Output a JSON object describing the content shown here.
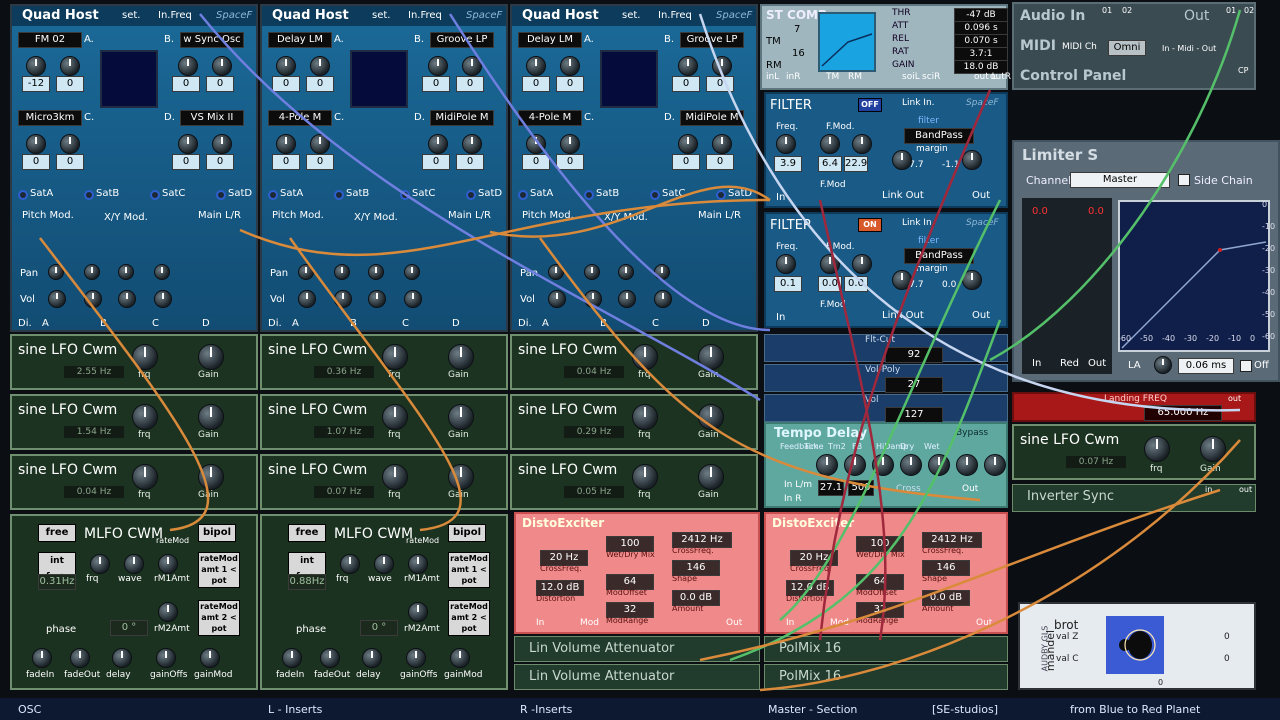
{
  "quad_hosts": [
    {
      "title": "Quad Host",
      "set": "set.",
      "infreq": "In.Freq",
      "spacef": "SpaceF",
      "slotA": "FM 02",
      "slotB": "w Sync Osc",
      "slotC": "Micro3km",
      "slotD": "VS Mix II",
      "letters": [
        "A.",
        "B.",
        "C.",
        "D."
      ],
      "vals": [
        "-12",
        "0",
        "0",
        "0",
        "0",
        "0",
        "0",
        "0",
        "0",
        "0",
        "-12",
        "0"
      ],
      "sats": [
        "SatA",
        "SatB",
        "SatC",
        "SatD"
      ],
      "pitch": "Pitch Mod.",
      "xymod": "X/Y Mod.",
      "mainlr": "Main L/R",
      "pan": "Pan",
      "vol": "Vol",
      "di": "Di.",
      "ab": [
        "A",
        "B",
        "C",
        "D"
      ]
    },
    {
      "title": "Quad Host",
      "set": "set.",
      "infreq": "In.Freq",
      "spacef": "SpaceF",
      "slotA": "Delay LM",
      "slotB": "Groove LP",
      "slotC": "4-Pole M",
      "slotD": "MidiPole M",
      "letters": [
        "A.",
        "B.",
        "C.",
        "D."
      ],
      "vals": [
        "0",
        "0",
        "0",
        "0",
        "0",
        "0",
        "0",
        "0",
        "0",
        "0",
        "0",
        "0"
      ],
      "sats": [
        "SatA",
        "SatB",
        "SatC",
        "SatD"
      ],
      "pitch": "Pitch Mod.",
      "xymod": "X/Y Mod.",
      "mainlr": "Main L/R",
      "pan": "Pan",
      "vol": "Vol",
      "di": "Di.",
      "ab": [
        "A",
        "B",
        "C",
        "D"
      ]
    },
    {
      "title": "Quad Host",
      "set": "set.",
      "infreq": "In.Freq",
      "spacef": "SpaceF",
      "slotA": "Delay LM",
      "slotB": "Groove LP",
      "slotC": "4-Pole M",
      "slotD": "MidiPole M",
      "letters": [
        "A.",
        "B.",
        "C.",
        "D."
      ],
      "vals": [
        "0",
        "0",
        "0",
        "0",
        "0",
        "0",
        "0",
        "0",
        "0",
        "0",
        "0",
        "0"
      ],
      "sats": [
        "SatA",
        "SatB",
        "SatC",
        "SatD"
      ],
      "pitch": "Pitch Mod.",
      "xymod": "X/Y Mod.",
      "mainlr": "Main L/R",
      "pan": "Pan",
      "vol": "Vol",
      "di": "Di.",
      "ab": [
        "A",
        "B",
        "C",
        "D"
      ]
    }
  ],
  "lfos": [
    [
      {
        "name": "sine LFO Cwm",
        "hz": "2.55 Hz"
      },
      {
        "name": "sine LFO Cwm",
        "hz": "1.54 Hz"
      },
      {
        "name": "sine LFO Cwm",
        "hz": "0.04 Hz"
      }
    ],
    [
      {
        "name": "sine LFO Cwm",
        "hz": "0.36 Hz"
      },
      {
        "name": "sine LFO Cwm",
        "hz": "1.07 Hz"
      },
      {
        "name": "sine LFO Cwm",
        "hz": "0.07 Hz"
      }
    ],
    [
      {
        "name": "sine LFO Cwm",
        "hz": "0.04 Hz"
      },
      {
        "name": "sine LFO Cwm",
        "hz": "0.29 Hz"
      },
      {
        "name": "sine LFO Cwm",
        "hz": "0.05 Hz"
      }
    ]
  ],
  "lfo_labels": {
    "frq": "frq",
    "gain": "Gain"
  },
  "mlfo": [
    {
      "title": "MLFO CWM",
      "free": "free",
      "bipol": "bipol",
      "intfrq": "int frq>",
      "hz": "0.31Hz",
      "deg": "0 °",
      "phase": "phase",
      "ratemod": "rateMod",
      "labels": [
        "frq",
        "wave",
        "rM1Amt",
        "rM2Amt",
        "fadeIn",
        "fadeOut",
        "delay",
        "gainOffs",
        "gainMod"
      ],
      "amt1": "rateMod amt 1 < pot",
      "amt2": "rateMod amt 2 < pot"
    },
    {
      "title": "MLFO CWM",
      "free": "free",
      "bipol": "bipol",
      "intfrq": "int frq>",
      "hz": "0.88Hz",
      "deg": "0 °",
      "phase": "phase",
      "ratemod": "rateMod",
      "labels": [
        "frq",
        "wave",
        "rM1Amt",
        "rM2Amt",
        "fadeIn",
        "fadeOut",
        "delay",
        "gainOffs",
        "gainMod"
      ],
      "amt1": "rateMod amt 1 < pot",
      "amt2": "rateMod amt 2 < pot"
    }
  ],
  "stcomp": {
    "title": "ST COMP",
    "n1": "7",
    "tm": "TM",
    "n2": "16",
    "rm": "RM",
    "inl": "inL",
    "inr": "inR",
    "soil": "soiL",
    "soir": "sciR",
    "outl": "out L",
    "outr": "outR",
    "params": [
      {
        "k": "THR",
        "v": "-47 dB"
      },
      {
        "k": "ATT",
        "v": "0.096 s"
      },
      {
        "k": "REL",
        "v": "0.070 s"
      },
      {
        "k": "RAT",
        "v": "3.7:1"
      },
      {
        "k": "GAIN",
        "v": "18.0 dB"
      }
    ]
  },
  "filters": [
    {
      "title": "FILTER",
      "state": "OFF",
      "link": "Link In.",
      "spacef": "SpaceF",
      "freq": "Freq.",
      "fmod": "F.Mod.",
      "type": "BandPass",
      "sub": "filter",
      "margin": "margin",
      "v1": "3.9",
      "v2": "6.4",
      "v3": "22.9",
      "v4": "-7.7",
      "v5": "-1.1",
      "in": "In",
      "fmod2": "F.Mod",
      "linkout": "Link Out",
      "out": "Out"
    },
    {
      "title": "FILTER",
      "state": "ON",
      "link": "Link In.",
      "spacef": "SpaceF",
      "freq": "Freq.",
      "fmod": "F.Mod.",
      "type": "BandPass",
      "sub": "filter",
      "margin": "margin",
      "v1": "0.1",
      "v2": "0.0",
      "v3": "0.0",
      "v4": "-7.7",
      "v5": "0.0",
      "in": "In",
      "fmod2": "F.Mod",
      "linkout": "Link Out",
      "out": "Out"
    }
  ],
  "mixer": [
    {
      "name": "Flt-Cut",
      "val": "92"
    },
    {
      "name": "Vol-Poly",
      "val": "27"
    },
    {
      "name": "Vol",
      "val": "127"
    }
  ],
  "tempo": {
    "title": "Tempo Delay",
    "bypass": "Bypass",
    "v1": "27.1",
    "v2": "500",
    "labels": [
      "Feedback",
      "Time",
      "Tm2",
      "FB",
      "HiDamp",
      "Dry",
      "Wet"
    ],
    "inlm": "In L/m",
    "inr": "In R",
    "cross": "Cross",
    "out": "Out"
  },
  "disto": [
    {
      "title": "DistoExciter",
      "cross": "20 Hz",
      "crosslbl": "CrossFreq.",
      "dist": "12.0 dB",
      "distlbl": "Distortion",
      "wet": "100",
      "wetlbl": "Wet/Dry Mix",
      "mod": "64",
      "modlbl": "ModOffset",
      "range": "32",
      "rangelbl": "ModRange",
      "cf2": "2412 Hz",
      "cf2lbl": "CrossFreq.",
      "shape": "146",
      "shapelbl": "Shape",
      "amt": "0.0 dB",
      "amtlbl": "Amount",
      "in": "In",
      "modin": "Mod",
      "out": "Out"
    },
    {
      "title": "DistoExciter",
      "cross": "20 Hz",
      "crosslbl": "CrossFreq.",
      "dist": "12.0 dB",
      "distlbl": "Distortion",
      "wet": "100",
      "wetlbl": "Wet/Dry Mix",
      "mod": "64",
      "modlbl": "ModOffset",
      "range": "32",
      "rangelbl": "ModRange",
      "cf2": "2412 Hz",
      "cf2lbl": "CrossFreq.",
      "shape": "146",
      "shapelbl": "Shape",
      "amt": "0.0 dB",
      "amtlbl": "Amount",
      "in": "In",
      "modin": "Mod",
      "out": "Out"
    }
  ],
  "lin": [
    "Lin Volume Attenuator",
    "Lin Volume Attenuator"
  ],
  "polmix": [
    "PolMix 16",
    "PolMix 16"
  ],
  "right": {
    "audioin": "Audio In",
    "out": "Out",
    "midi": "MIDI",
    "midich": "MIDI Ch",
    "omni": "Omni",
    "midiio": "In - Midi - Out",
    "control": "Control Panel",
    "jacks": [
      "01",
      "02",
      "01",
      "02"
    ],
    "cp": "CP",
    "limiter": {
      "title": "Limiter S",
      "channel": "Channel",
      "master": "Master",
      "sidechain": "Side Chain",
      "meter_top": [
        "0.0",
        "0.0"
      ],
      "in": "In",
      "red": "Red",
      "out": "Out",
      "la": "LA",
      "ms": "0.06 ms",
      "off": "Off",
      "axis_x": [
        "-60",
        "-50",
        "-40",
        "-30",
        "-20",
        "-10",
        "0"
      ],
      "axis_y": [
        "0",
        "-10",
        "-20",
        "-30",
        "-40",
        "-50",
        "-60"
      ]
    },
    "landing": {
      "title": "Landing FREQ",
      "val": "65.000 Hz",
      "out": "out"
    },
    "lfo": {
      "name": "sine LFO Cwm",
      "hz": "0.07 Hz",
      "frq": "frq",
      "gain": "Gain"
    },
    "inverter": {
      "name": "Inverter Sync",
      "in": "in",
      "out": "out"
    },
    "mandel": {
      "title": "brot",
      "brand": "mandel",
      "side": "AUDBY GLS",
      "valz": "val Z",
      "valc": "val C",
      "n0": "0",
      "n1": "0",
      "n2": "0"
    }
  },
  "status": {
    "s1": "OSC",
    "s2": "L - Inserts",
    "s3": "R -Inserts",
    "s4": "Master - Section",
    "s5": "[SE-studios]",
    "s6": "from Blue to Red Planet"
  }
}
